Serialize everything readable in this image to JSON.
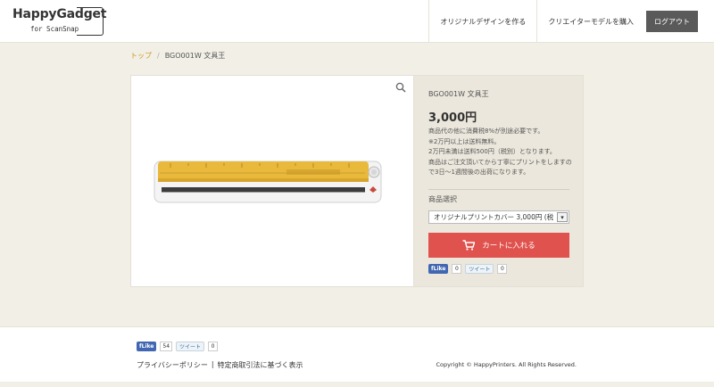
{
  "header": {
    "logo": {
      "name": "HappyGadget",
      "tagline": "for ScanSnap"
    },
    "nav": [
      {
        "label": "オリジナルデザインを作る"
      },
      {
        "label": "クリエイターモデルを購入"
      }
    ],
    "logout_label": "ログアウト"
  },
  "breadcrumb": {
    "home": "トップ",
    "separator": "/",
    "current": "BGO001W 文具王"
  },
  "product": {
    "name": "BGO001W 文具王",
    "price": "3,000円",
    "description": [
      "商品代の他に消費税8%が別途必要です。",
      "※2万円以上は送料無料。",
      "2万円未満は送料500円（税別）となります。",
      "商品はご注文頂いてから丁寧にプリントをしますので3日〜1週間後の出荷になります。"
    ],
    "select_label": "商品選択",
    "select_value": "オリジナルプリントカバー 3,000円 (税",
    "cart_label": "カートに入れる",
    "social": {
      "like": "Like",
      "like_count": "0",
      "tweet": "ツイート",
      "tweet_count": "0"
    }
  },
  "footer": {
    "social": {
      "like": "Like",
      "like_count": "54",
      "tweet": "ツイート",
      "tweet_count": "0"
    },
    "links": [
      "プライバシーポリシー",
      "特定商取引法に基づく表示"
    ],
    "link_separator": "|",
    "copyright": "Copyright © HappyPrinters. All Rights Reserved."
  },
  "colors": {
    "accent": "#d09a22",
    "cart": "#e0524e",
    "logout": "#5a5a5a",
    "panel": "#ebe7dc",
    "page": "#f1efe6"
  },
  "icons": {
    "zoom": "search-icon",
    "cart": "cart-icon"
  }
}
